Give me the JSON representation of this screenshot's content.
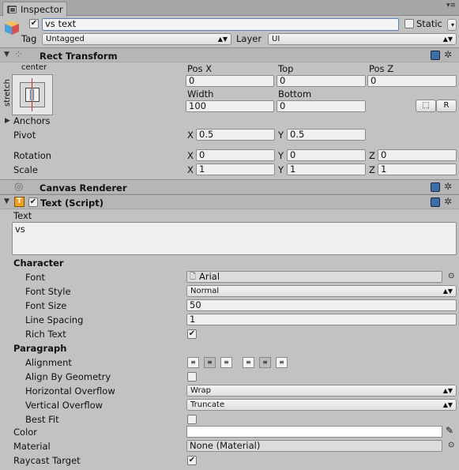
{
  "tab": {
    "title": "Inspector"
  },
  "object": {
    "name": "vs text",
    "static_label": "Static",
    "tag_label": "Tag",
    "tag_value": "Untagged",
    "layer_label": "Layer",
    "layer_value": "UI"
  },
  "rect_transform": {
    "title": "Rect Transform",
    "anchor_h": "center",
    "anchor_v": "stretch",
    "col1": "Pos X",
    "col2": "Top",
    "col3": "Pos Z",
    "pos_x": "0",
    "top": "0",
    "pos_z": "0",
    "width_label": "Width",
    "bottom_label": "Bottom",
    "width": "100",
    "bottom": "0",
    "r_button": "R",
    "anchors": "Anchors",
    "pivot": "Pivot",
    "pivot_x": "0.5",
    "pivot_y": "0.5",
    "rotation": "Rotation",
    "rot_x": "0",
    "rot_y": "0",
    "rot_z": "0",
    "scale": "Scale",
    "scale_x": "1",
    "scale_y": "1",
    "scale_z": "1",
    "x": "X",
    "y": "Y",
    "z": "Z"
  },
  "canvas_renderer": {
    "title": "Canvas Renderer"
  },
  "text_script": {
    "title": "Text (Script)",
    "text_label": "Text",
    "text_value": "vs",
    "character": "Character",
    "font_label": "Font",
    "font_value": "Arial",
    "font_style_label": "Font Style",
    "font_style_value": "Normal",
    "font_size_label": "Font Size",
    "font_size_value": "50",
    "line_spacing_label": "Line Spacing",
    "line_spacing_value": "1",
    "rich_text_label": "Rich Text",
    "paragraph": "Paragraph",
    "alignment_label": "Alignment",
    "align_geometry_label": "Align By Geometry",
    "h_overflow_label": "Horizontal Overflow",
    "h_overflow_value": "Wrap",
    "v_overflow_label": "Vertical Overflow",
    "v_overflow_value": "Truncate",
    "best_fit_label": "Best Fit",
    "color_label": "Color",
    "material_label": "Material",
    "material_value": "None (Material)",
    "raycast_label": "Raycast Target"
  },
  "icons": [
    "inspector-tab-icon",
    "gameobject-cube-icon",
    "rect-transform-icon",
    "canvas-renderer-icon",
    "text-script-icon",
    "help-book-icon",
    "gear-icon",
    "eyedropper-icon",
    "object-picker-icon"
  ]
}
